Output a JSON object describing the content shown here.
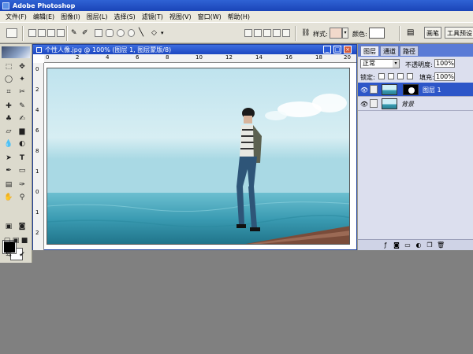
{
  "app": {
    "title": "Adobe Photoshop"
  },
  "menu": [
    "文件(F)",
    "编辑(E)",
    "图像(I)",
    "图层(L)",
    "选择(S)",
    "滤镜(T)",
    "视图(V)",
    "窗口(W)",
    "帮助(H)"
  ],
  "options": {
    "style_label": "样式:",
    "color_label": "颜色:",
    "palette_tabs": [
      "画笔",
      "工具预设"
    ]
  },
  "document": {
    "title": "个性人像.jpg @ 100% (图层 1, 图层蒙版/8)",
    "ruler_numbers": [
      "0",
      "2",
      "4",
      "6",
      "8",
      "10",
      "12",
      "14",
      "16",
      "18",
      "20"
    ],
    "left_ruler_numbers": [
      "0",
      "2",
      "4",
      "6",
      "8",
      "1",
      "0",
      "1",
      "2"
    ]
  },
  "layers_panel": {
    "tabs": [
      "图层",
      "通道",
      "路径"
    ],
    "blend_mode": "正常",
    "opacity_label": "不透明度:",
    "opacity_value": "100%",
    "lock_label": "锁定:",
    "fill_label": "填充:",
    "fill_value": "100%",
    "layers": [
      {
        "name": "图层 1",
        "selected": true,
        "has_mask": true
      },
      {
        "name": "背景",
        "selected": false,
        "has_mask": false
      }
    ]
  },
  "colors": {
    "foreground": "#000000",
    "background": "#ffffff",
    "titlebar": "#1b45b8"
  }
}
